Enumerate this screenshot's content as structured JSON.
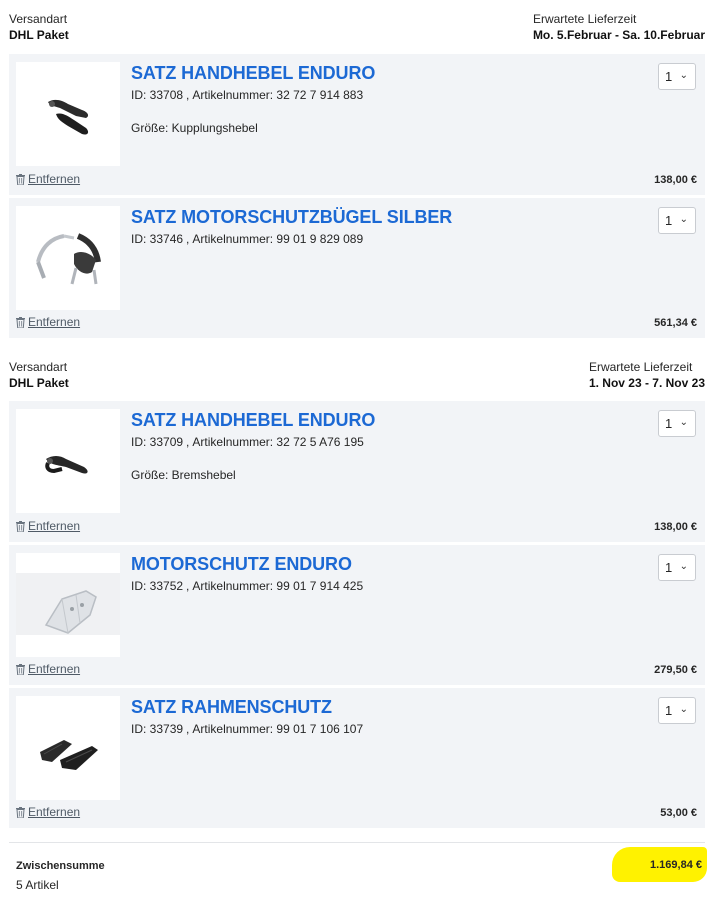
{
  "shipments": [
    {
      "method_label": "Versandart",
      "method_value": "DHL Paket",
      "delivery_label": "Erwartete Lieferzeit",
      "delivery_value": "Mo. 5.Februar - Sa. 10.Februar",
      "items": [
        {
          "title": "SATZ HANDHEBEL ENDURO",
          "id_text": "ID: 33708",
          "article_text": "Artikelnummer: 32 72 7 914 883",
          "size_text": "Größe: Kupplungshebel",
          "quantity": "1",
          "remove_label": "Entfernen",
          "price": "138,00 €",
          "image": "clutch-lever-image"
        },
        {
          "title": "SATZ MOTORSCHUTZBÜGEL SILBER",
          "id_text": "ID: 33746",
          "article_text": "Artikelnummer: 99 01 9 829 089",
          "size_text": "",
          "quantity": "1",
          "remove_label": "Entfernen",
          "price": "561,34 €",
          "image": "crash-bar-image"
        }
      ]
    },
    {
      "method_label": "Versandart",
      "method_value": "DHL Paket",
      "delivery_label": "Erwartete Lieferzeit",
      "delivery_value": "1. Nov 23 - 7. Nov 23",
      "items": [
        {
          "title": "SATZ HANDHEBEL ENDURO",
          "id_text": "ID: 33709",
          "article_text": "Artikelnummer: 32 72 5 A76 195",
          "size_text": "Größe: Bremshebel",
          "quantity": "1",
          "remove_label": "Entfernen",
          "price": "138,00 €",
          "image": "brake-lever-image"
        },
        {
          "title": "MOTORSCHUTZ ENDURO",
          "id_text": "ID: 33752",
          "article_text": "Artikelnummer: 99 01 7 914 425",
          "size_text": "",
          "quantity": "1",
          "remove_label": "Entfernen",
          "price": "279,50 €",
          "image": "skid-plate-image"
        },
        {
          "title": "SATZ RAHMENSCHUTZ",
          "id_text": "ID: 33739",
          "article_text": "Artikelnummer: 99 01 7 106 107",
          "size_text": "",
          "quantity": "1",
          "remove_label": "Entfernen",
          "price": "53,00 €",
          "image": "frame-guard-image"
        }
      ]
    }
  ],
  "summary": {
    "subtotal_label": "Zwischensumme",
    "item_count": "5 Artikel",
    "total": "1.169,84 €",
    "highlight_color": "#fff200"
  },
  "colors": {
    "title_blue": "#1c69d4",
    "card_bg": "#f2f4f7"
  }
}
